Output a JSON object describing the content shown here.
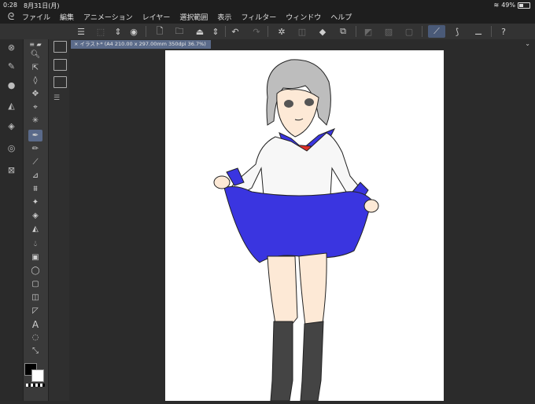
{
  "status": {
    "time": "0:28",
    "date": "8月31日(月)",
    "battery": "49%"
  },
  "menu": {
    "items": [
      "ファイル",
      "編集",
      "アニメーション",
      "レイヤー",
      "選択範囲",
      "表示",
      "フィルター",
      "ウィンドウ",
      "ヘルプ"
    ]
  },
  "toolbar": {
    "icons": [
      "menu-icon",
      "new-icon",
      "up-down-icon",
      "eye-icon",
      "new-file-icon",
      "open-folder-icon",
      "save-icon",
      "undo-icon",
      "redo-icon",
      "loading-icon",
      "cancel-icon",
      "fill-icon",
      "transform-icon",
      "hide-icon",
      "clear-icon",
      "blank-icon",
      "pen-icon",
      "brush-icon",
      "settings-icon",
      "help-icon"
    ]
  },
  "tab": {
    "label": "イラスト* (A4 210.00 x 297.00mm 350dpi 36.7%)"
  },
  "colors": {
    "foreground": "#000000",
    "background": "#ffffff",
    "accent": "#5b6b8a",
    "skirt": "#3a35e0",
    "tie": "#e0302a"
  }
}
